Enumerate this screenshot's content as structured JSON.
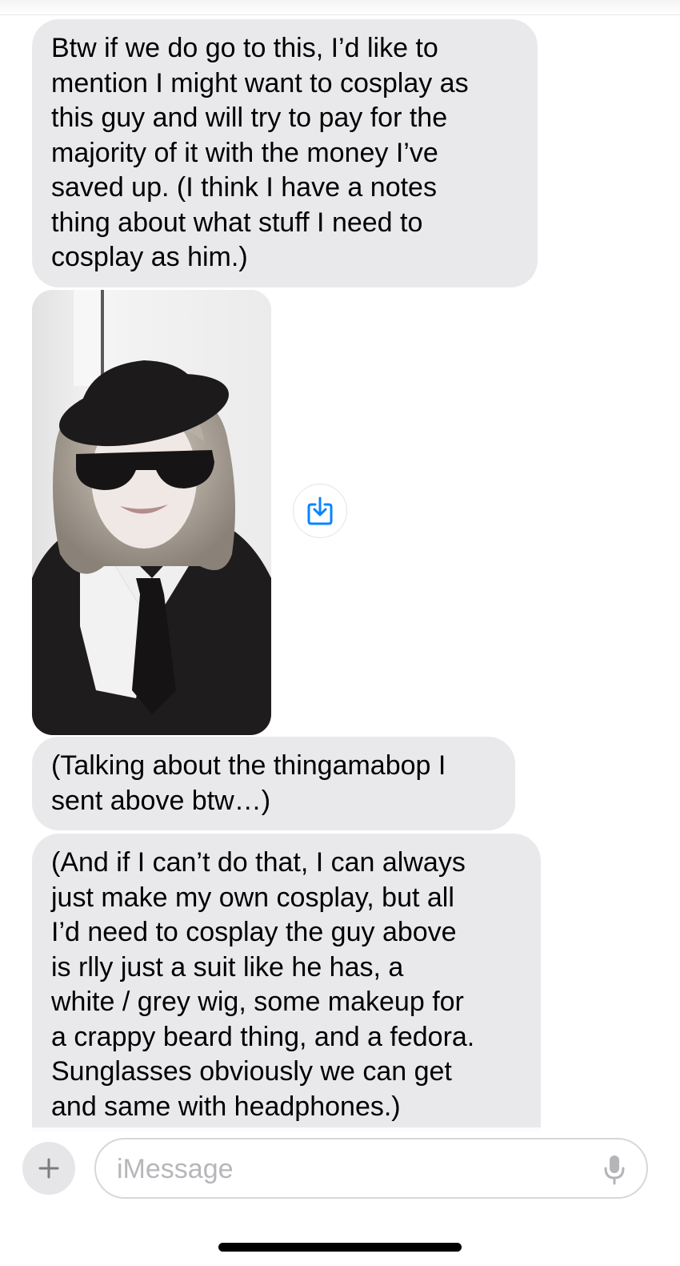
{
  "messages": [
    {
      "id": 1,
      "type": "text",
      "text": "Btw if we do go to this, I’d like to\nmention I might want to cosplay as\nthis guy and will try to pay for the\nmajority of it with the money I’ve\nsaved up. (I think I have a notes\nthing about what stuff I need to\ncosplay as him.)"
    },
    {
      "id": 2,
      "type": "photo",
      "icon": "save-to-photos-icon"
    },
    {
      "id": 3,
      "type": "text",
      "text": "(Talking about the thingamabop I\nsent above btw…)"
    },
    {
      "id": 4,
      "type": "text",
      "text": "(And if I can’t do that, I can always\njust make my own cosplay, but all\nI’d need to cosplay the guy above\nis rlly just a suit like he has, a\nwhite / grey wig, some makeup for\na crappy beard thing, and a fedora.\nSunglasses obviously we can get\nand same with headphones.)"
    }
  ],
  "composer": {
    "placeholder": "iMessage",
    "plus_icon": "plus-icon",
    "mic_icon": "microphone-icon"
  },
  "colors": {
    "bubble_gray": "#e9e9eb",
    "accent_blue": "#0a84ff",
    "background": "#ffffff"
  }
}
